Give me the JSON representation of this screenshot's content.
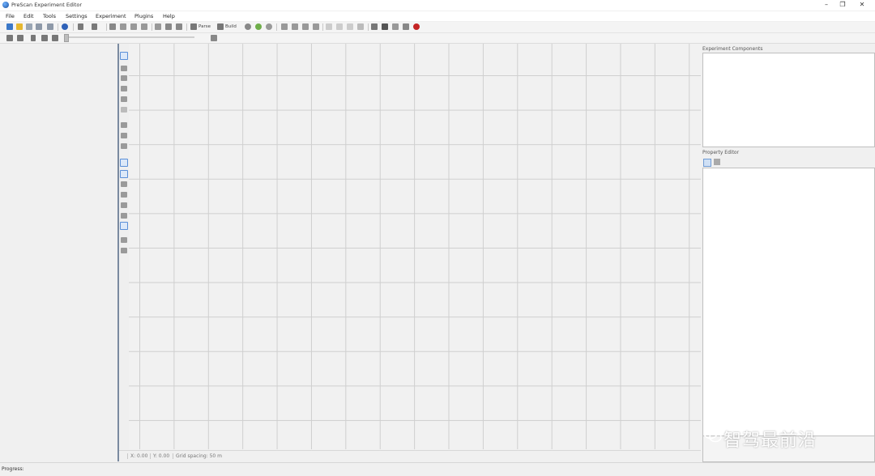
{
  "window": {
    "title": "PreScan Experiment Editor",
    "controls": [
      "–",
      "❐",
      "✕"
    ]
  },
  "menu": [
    "File",
    "Edit",
    "Tools",
    "Settings",
    "Experiment",
    "Plugins",
    "Help"
  ],
  "toolbar": {
    "parse_label": "Parse",
    "build_label": "Build"
  },
  "coords": {
    "x": "X: 0.00",
    "y": "Y: 0.00",
    "grid": "Grid spacing: 50 m"
  },
  "right_panel": {
    "experiment_title": "Experiment Components",
    "property_title": "Property Editor"
  },
  "watermark": "智驾最前沿",
  "status": {
    "progress_label": "Progress:"
  }
}
